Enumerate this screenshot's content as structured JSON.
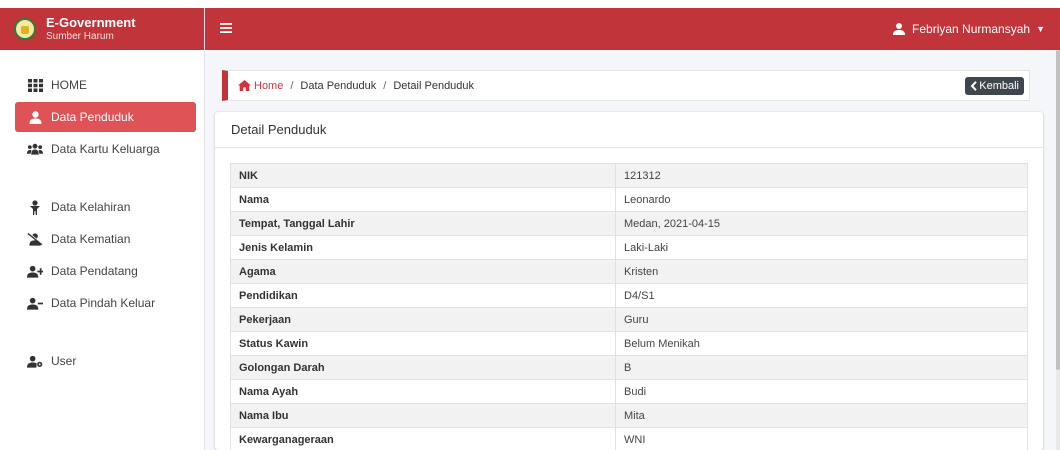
{
  "brand": {
    "title": "E-Government",
    "subtitle": "Sumber Harum"
  },
  "sidebar": {
    "items": [
      {
        "label": "HOME",
        "icon": "grid-icon"
      },
      {
        "label": "Data Penduduk",
        "icon": "user-icon",
        "active": true
      },
      {
        "label": "Data Kartu Keluarga",
        "icon": "users-icon"
      },
      {
        "label": "Data Kelahiran",
        "icon": "baby-icon"
      },
      {
        "label": "Data Kematian",
        "icon": "user-slash-icon"
      },
      {
        "label": "Data Pendatang",
        "icon": "user-plus-icon"
      },
      {
        "label": "Data Pindah Keluar",
        "icon": "user-minus-icon"
      },
      {
        "label": "User",
        "icon": "user-cog-icon"
      }
    ]
  },
  "navbar": {
    "user_name": "Febriyan Nurmansyah"
  },
  "breadcrumb": {
    "home": "Home",
    "items": [
      "Data Penduduk",
      "Detail Penduduk"
    ],
    "back_label": "Kembali"
  },
  "card": {
    "title": "Detail Penduduk",
    "rows": [
      {
        "key": "NIK",
        "value": "121312"
      },
      {
        "key": "Nama",
        "value": "Leonardo"
      },
      {
        "key": "Tempat, Tanggal Lahir",
        "value": "Medan, 2021-04-15"
      },
      {
        "key": "Jenis Kelamin",
        "value": "Laki-Laki"
      },
      {
        "key": "Agama",
        "value": "Kristen"
      },
      {
        "key": "Pendidikan",
        "value": "D4/S1"
      },
      {
        "key": "Pekerjaan",
        "value": "Guru"
      },
      {
        "key": "Status Kawin",
        "value": "Belum Menikah"
      },
      {
        "key": "Golongan Darah",
        "value": "B"
      },
      {
        "key": "Nama Ayah",
        "value": "Budi"
      },
      {
        "key": "Nama Ibu",
        "value": "Mita"
      },
      {
        "key": "Kewarganageraan",
        "value": "WNI"
      }
    ]
  },
  "colors": {
    "primary": "#c0343a",
    "active_menu": "#df5256",
    "back_button": "#3f474e"
  }
}
